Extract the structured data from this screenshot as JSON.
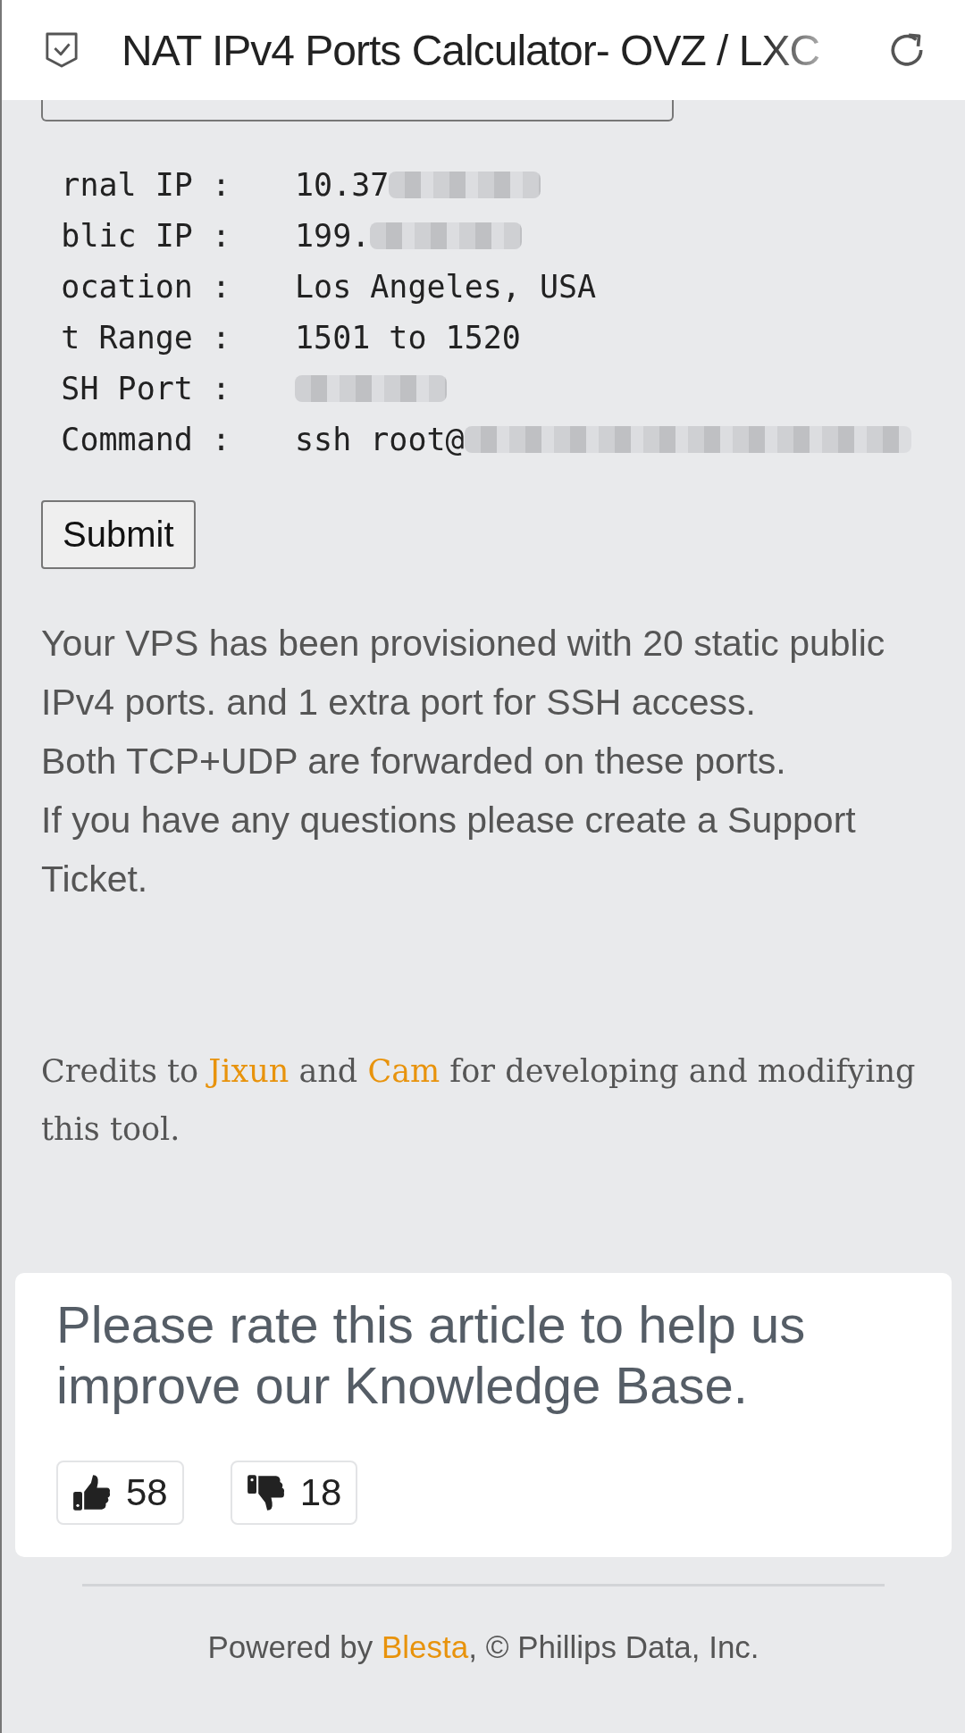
{
  "header": {
    "title": "NAT IPv4 Ports Calculator- OVZ / LXC"
  },
  "result_rows": [
    {
      "label": "rnal IP :",
      "value": "10.37",
      "redacted": true
    },
    {
      "label": "blic IP :",
      "value": "199.",
      "redacted": true
    },
    {
      "label": "ocation :",
      "value": "Los Angeles, USA",
      "redacted": false
    },
    {
      "label": "t Range :",
      "value": "1501 to 1520",
      "redacted": false
    },
    {
      "label": "SH Port :",
      "value": "",
      "redacted": true
    },
    {
      "label": "Command :",
      "value": "ssh root@",
      "redacted": true
    }
  ],
  "submit_button": "Submit",
  "info_lines": [
    "Your VPS has been provisioned with 20 static public IPv4 ports. and 1 extra port for SSH access.",
    "Both TCP+UDP are forwarded on these ports.",
    "If you have any questions please create a Support Ticket."
  ],
  "credits": [
    {
      "kind": "text",
      "text": "Credits to "
    },
    {
      "kind": "link",
      "text": "Jixun"
    },
    {
      "kind": "text",
      "text": " and "
    },
    {
      "kind": "link",
      "text": "Cam"
    },
    {
      "kind": "text",
      "text": " for developing and modifying this tool."
    }
  ],
  "rating": {
    "prompt": "Please rate this article to help us improve our Knowledge Base.",
    "votes": [
      {
        "kind": "up",
        "count": "58"
      },
      {
        "kind": "down",
        "count": "18"
      }
    ]
  },
  "footer": [
    {
      "kind": "text",
      "text": "Powered by "
    },
    {
      "kind": "link",
      "text": "Blesta"
    },
    {
      "kind": "text",
      "text": ", © Phillips Data, Inc."
    }
  ]
}
